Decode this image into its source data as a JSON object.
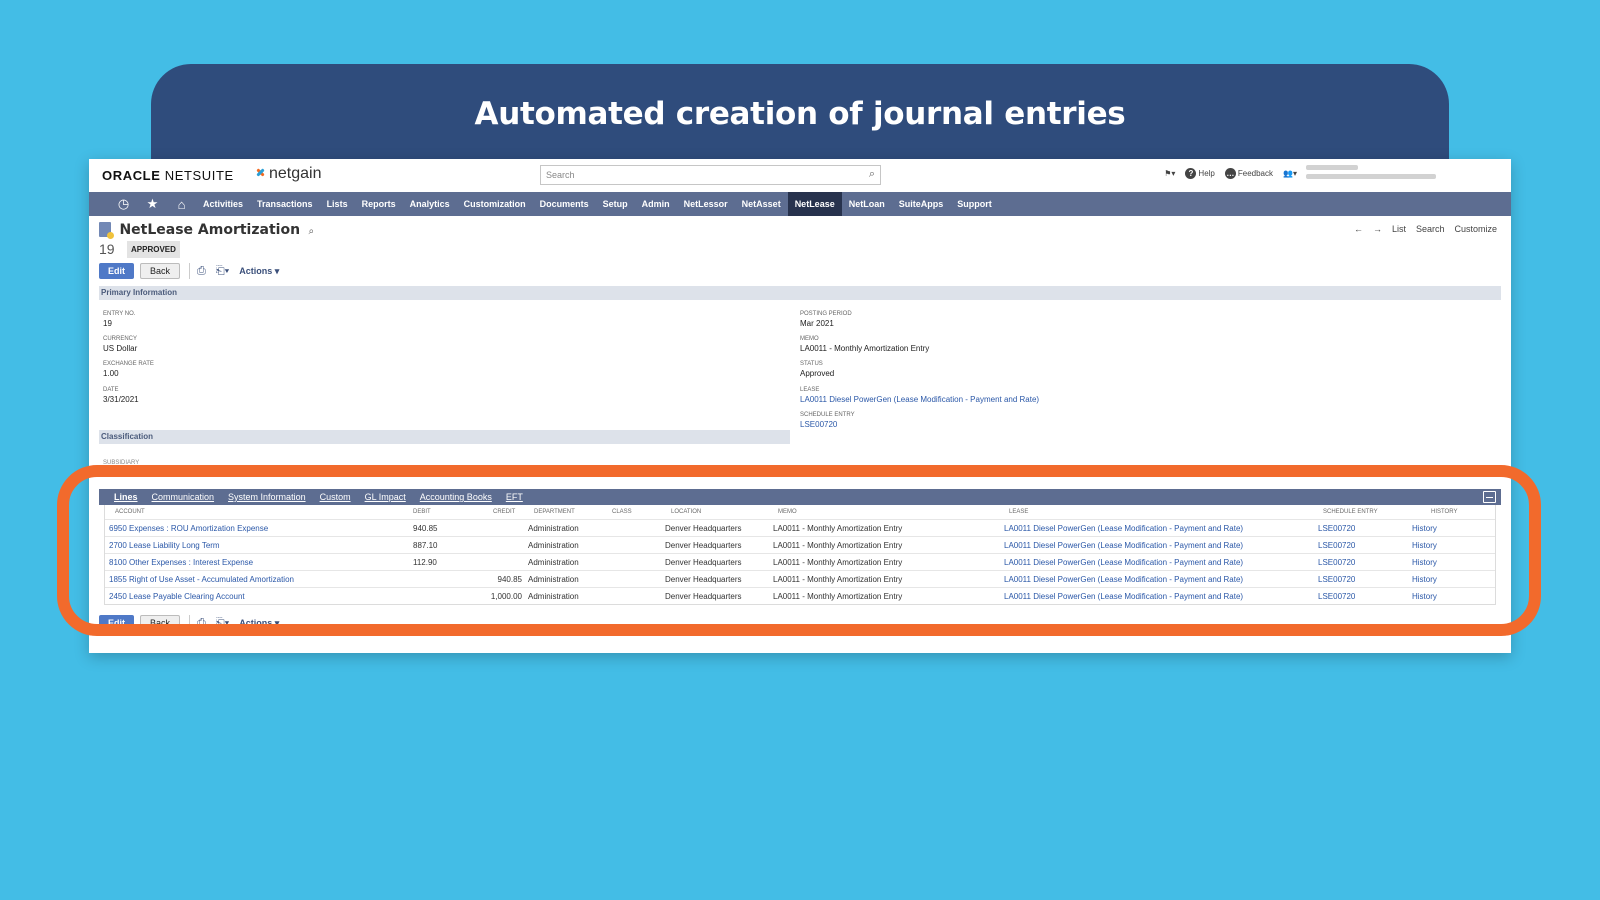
{
  "banner": {
    "title": "Automated creation of journal entries"
  },
  "header": {
    "brand_oracle": "ORACLE",
    "brand_netsuite": "NETSUITE",
    "brand_netgain": "netgain",
    "search_placeholder": "Search",
    "help": "Help",
    "feedback": "Feedback"
  },
  "nav": {
    "items": [
      "Activities",
      "Transactions",
      "Lists",
      "Reports",
      "Analytics",
      "Customization",
      "Documents",
      "Setup",
      "Admin",
      "NetLessor",
      "NetAsset",
      "NetLease",
      "NetLoan",
      "SuiteApps",
      "Support"
    ],
    "active": "NetLease"
  },
  "record": {
    "title": "NetLease Amortization",
    "number": "19",
    "status_badge": "APPROVED",
    "page_nav": {
      "list": "List",
      "search": "Search",
      "customize": "Customize"
    }
  },
  "buttons": {
    "edit": "Edit",
    "back": "Back",
    "actions": "Actions"
  },
  "primary": {
    "section_title": "Primary Information",
    "entry_no_label": "ENTRY NO.",
    "entry_no": "19",
    "currency_label": "CURRENCY",
    "currency": "US Dollar",
    "exchange_rate_label": "EXCHANGE RATE",
    "exchange_rate": "1.00",
    "date_label": "DATE",
    "date": "3/31/2021",
    "posting_period_label": "POSTING PERIOD",
    "posting_period": "Mar 2021",
    "memo_label": "MEMO",
    "memo": "LA0011 - Monthly Amortization Entry",
    "status_label": "STATUS",
    "status": "Approved",
    "lease_label": "LEASE",
    "lease": "LA0011 Diesel PowerGen (Lease Modification - Payment and Rate)",
    "schedule_entry_label": "SCHEDULE ENTRY",
    "schedule_entry": "LSE00720"
  },
  "classification": {
    "section_title": "Classification",
    "subsidiary_label": "SUBSIDIARY"
  },
  "tabs": [
    "Lines",
    "Communication",
    "System Information",
    "Custom",
    "GL Impact",
    "Accounting Books",
    "EFT"
  ],
  "lines": {
    "columns": [
      "ACCOUNT",
      "DEBIT",
      "CREDIT",
      "DEPARTMENT",
      "CLASS",
      "LOCATION",
      "MEMO",
      "LEASE",
      "SCHEDULE ENTRY",
      "HISTORY"
    ],
    "rows": [
      {
        "account": "6950 Expenses : ROU Amortization Expense",
        "debit": "940.85",
        "credit": "",
        "department": "Administration",
        "class": "",
        "location": "Denver Headquarters",
        "memo": "LA0011 - Monthly Amortization Entry",
        "lease": "LA0011 Diesel PowerGen (Lease Modification - Payment and Rate)",
        "schedule_entry": "LSE00720",
        "history": "History"
      },
      {
        "account": "2700 Lease Liability Long Term",
        "debit": "887.10",
        "credit": "",
        "department": "Administration",
        "class": "",
        "location": "Denver Headquarters",
        "memo": "LA0011 - Monthly Amortization Entry",
        "lease": "LA0011 Diesel PowerGen (Lease Modification - Payment and Rate)",
        "schedule_entry": "LSE00720",
        "history": "History"
      },
      {
        "account": "8100 Other Expenses : Interest Expense",
        "debit": "112.90",
        "credit": "",
        "department": "Administration",
        "class": "",
        "location": "Denver Headquarters",
        "memo": "LA0011 - Monthly Amortization Entry",
        "lease": "LA0011 Diesel PowerGen (Lease Modification - Payment and Rate)",
        "schedule_entry": "LSE00720",
        "history": "History"
      },
      {
        "account": "1855 Right of Use Asset - Accumulated Amortization",
        "debit": "",
        "credit": "940.85",
        "department": "Administration",
        "class": "",
        "location": "Denver Headquarters",
        "memo": "LA0011 - Monthly Amortization Entry",
        "lease": "LA0011 Diesel PowerGen (Lease Modification - Payment and Rate)",
        "schedule_entry": "LSE00720",
        "history": "History"
      },
      {
        "account": "2450 Lease Payable Clearing Account",
        "debit": "",
        "credit": "1,000.00",
        "department": "Administration",
        "class": "",
        "location": "Denver Headquarters",
        "memo": "LA0011 - Monthly Amortization Entry",
        "lease": "LA0011 Diesel PowerGen (Lease Modification - Payment and Rate)",
        "schedule_entry": "LSE00720",
        "history": "History"
      }
    ]
  },
  "colors": {
    "nav": "#5d6d91",
    "nav_active": "#27324d",
    "highlight": "#f26a2c",
    "background": "#43bde6",
    "banner": "#2f4c7c",
    "link": "#2b58a8"
  },
  "icons": [
    "recent-icon",
    "star-icon",
    "home-icon",
    "search-icon",
    "help-icon",
    "feedback-icon",
    "print-icon",
    "new-icon",
    "back-arrow-icon",
    "forward-arrow-icon",
    "collapse-icon"
  ]
}
